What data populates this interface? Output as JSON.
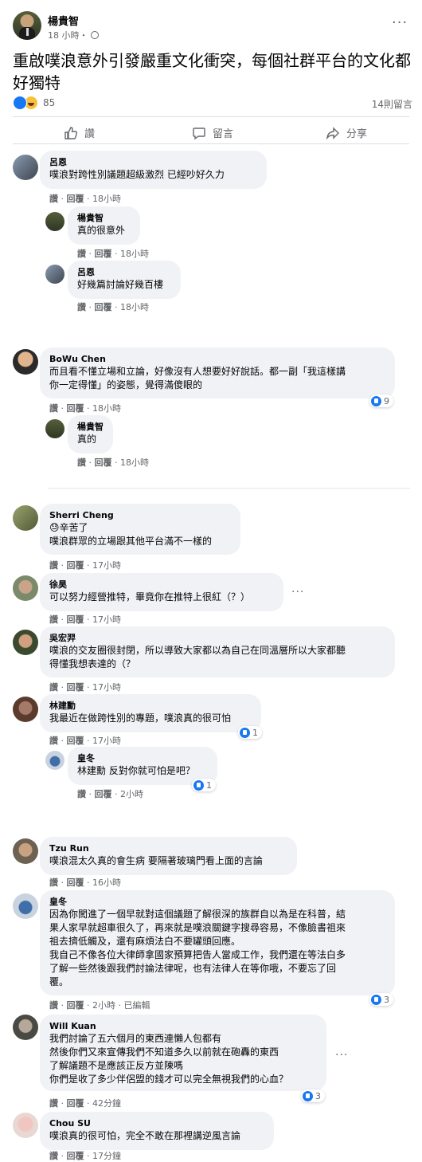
{
  "post": {
    "author": "楊貴智",
    "time": "18 小時・",
    "title": "重啟噗浪意外引發嚴重文化衝突，每個社群平台的文化都好獨特",
    "reaction_count": "85",
    "comment_count": "14則留言",
    "more": "···"
  },
  "actions": {
    "like": "讚",
    "comment": "留言",
    "share": "分享"
  },
  "meta_common": {
    "like": "讚",
    "reply": "回覆"
  },
  "comments": [
    {
      "name": "呂恩",
      "text": "噗浪對跨性別議題超級激烈 已經吵好久力",
      "time": "18小時"
    },
    {
      "name": "楊貴智",
      "text": "真的很意外",
      "time": "18小時"
    },
    {
      "name": "呂恩",
      "text": "好幾篇討論好幾百樓",
      "time": "18小時"
    },
    {
      "name": "BoWu Chen",
      "text": "而且看不懂立場和立論，好像沒有人想要好好說話。都一副「我這樣講\n你一定得懂」的姿態，覺得滿傻眼的",
      "time": "18小時",
      "reactions": "9"
    },
    {
      "name": "楊貴智",
      "text": "真的",
      "time": "18小時"
    },
    {
      "name": "Sherri Cheng",
      "text": "😓辛苦了\n噗浪群眾的立場跟其他平台滿不一樣的",
      "time": "17小時"
    },
    {
      "name": "徐昊",
      "text": "可以努力經營推特，畢竟你在推特上很紅（？）",
      "time": "17小時"
    },
    {
      "name": "吳宏羿",
      "text": "噗浪的交友圈很封閉，所以導致大家都以為自己在同溫層所以大家都聽\n得懂我想表達的（？",
      "time": "17小時"
    },
    {
      "name": "林建勳",
      "text": "我最近在做跨性別的專題，噗浪真的很可怕",
      "time": "17小時",
      "reactions": "1"
    },
    {
      "name": "皇冬",
      "text": "林建勳 反對你就可怕是吧？",
      "time": "2小時",
      "reactions": "1"
    },
    {
      "name": "Tzu Run",
      "text": "噗浪混太久真的會生病 要隔著玻璃門看上面的言論",
      "time": "16小時"
    },
    {
      "name": "皇冬",
      "text": "因為你闖進了一個早就對這個議題了解很深的族群自以為是在科普，結\n果人家早就超車很久了，再來就是噗浪關鍵字搜尋容易，不像臉書祖來\n祖去擠低觸及，還有麻煩法白不要罐頭回應。\n我自己不像各位大律師拿國家預算把告人當成工作，我們還在等法白多\n了解一些然後跟我們討論法律呢，也有法律人在等你哦，不要忘了回\n覆。",
      "time": "2小時",
      "edited": "已編輯",
      "reactions": "3"
    },
    {
      "name": "Will Kuan",
      "text": "我們討論了五六個月的東西連懶人包都有\n然後你們又來宣傳我們不知道多久以前就在砲轟的東西\n了解議題不是應該正反方並陳嗎\n你們是收了多少伴侶盟的錢才可以完全無視我們的心血？",
      "time": "42分鐘",
      "reactions": "3"
    },
    {
      "name": "Chou SU",
      "text": "噗浪真的很可怕，完全不敢在那裡講逆風言論",
      "time": "17分鐘"
    }
  ],
  "colors": {
    "accent": "#1877f2",
    "bubble": "#f0f2f5",
    "meta": "#65676b"
  }
}
